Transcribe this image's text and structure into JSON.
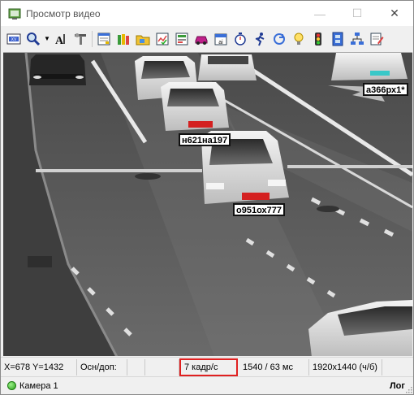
{
  "window": {
    "title": "Просмотр видео",
    "minimize_glyph": "—",
    "maximize_glyph": "☐",
    "close_glyph": "✕"
  },
  "toolbar": {
    "items": [
      "video-file-icon",
      "magnifier-icon",
      "dropdown-arrow-icon",
      "text-settings-icon",
      "tools-icon",
      "report-icon",
      "books-icon",
      "folder-open-icon",
      "chart-check-icon",
      "settings-list-icon",
      "car-icon",
      "calendar-icon",
      "stopwatch-icon",
      "runner-icon",
      "refresh-icon",
      "lightbulb-icon",
      "traffic-light-icon",
      "film-icon",
      "network-icon",
      "edit-form-icon"
    ],
    "text_settings_label": "A"
  },
  "video": {
    "plates": [
      {
        "text": "а366рх1*",
        "color": "#39c8c8"
      },
      {
        "text": "н621на197",
        "color": "#d42020"
      },
      {
        "text": "о951ох777",
        "color": "#d42020"
      }
    ]
  },
  "status": {
    "coords": "X=678 Y=1432",
    "osn_dop": "Осн/доп:",
    "fps": "7 кадр/с",
    "timing": "1540 / 63 мс",
    "resolution": "1920x1440 (ч/б)"
  },
  "bottom": {
    "camera": "Камера 1",
    "log": "Лог"
  },
  "colors": {
    "highlight": "#e02020",
    "camera_ok": "#2aa21a"
  }
}
